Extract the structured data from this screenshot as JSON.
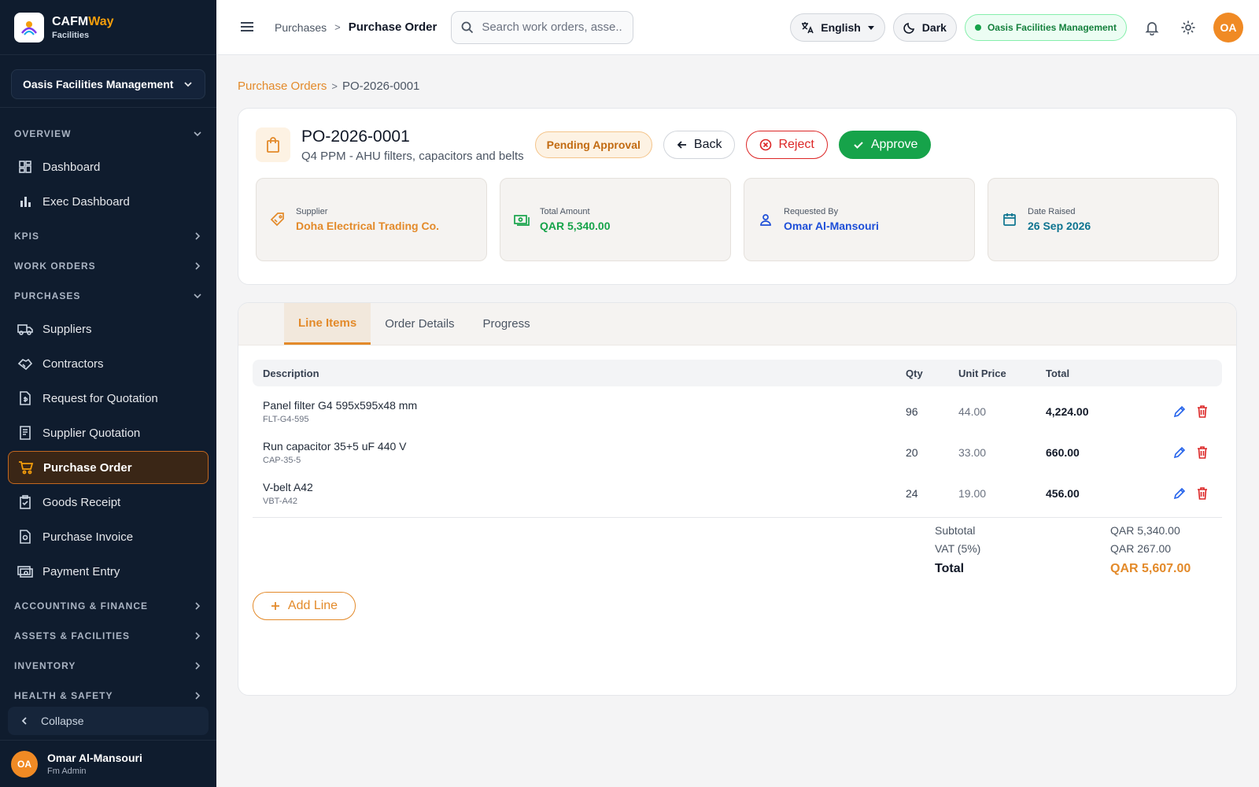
{
  "brand": {
    "name_main": "CAFM",
    "name_accent": "Way",
    "subtitle": "Facilities"
  },
  "sidebar": {
    "org": "Oasis Facilities Management",
    "sections": {
      "overview": "OVERVIEW",
      "kpis": "KPIS",
      "work_orders": "WORK ORDERS",
      "purchases": "PURCHASES",
      "accounting": "ACCOUNTING & FINANCE",
      "assets": "ASSETS & FACILITIES",
      "inventory": "INVENTORY",
      "health": "HEALTH & SAFETY"
    },
    "overview_items": [
      {
        "label": "Dashboard",
        "icon": "dashboard-icon"
      },
      {
        "label": "Exec Dashboard",
        "icon": "bar-chart-icon"
      }
    ],
    "purchase_items": [
      {
        "label": "Suppliers",
        "icon": "truck-icon"
      },
      {
        "label": "Contractors",
        "icon": "handshake-icon"
      },
      {
        "label": "Request for Quotation",
        "icon": "document-dollar-icon"
      },
      {
        "label": "Supplier Quotation",
        "icon": "receipt-icon"
      },
      {
        "label": "Purchase Order",
        "icon": "cart-icon",
        "active": true
      },
      {
        "label": "Goods Receipt",
        "icon": "clipboard-check-icon"
      },
      {
        "label": "Purchase Invoice",
        "icon": "invoice-icon"
      },
      {
        "label": "Payment Entry",
        "icon": "payment-icon"
      }
    ],
    "collapse_label": "Collapse",
    "user": {
      "initials": "OA",
      "name": "Omar Al-Mansouri",
      "role": "Fm Admin"
    }
  },
  "header": {
    "breadcrumb_parent": "Purchases",
    "breadcrumb_current": "Purchase Order",
    "search_placeholder": "Search work orders, asse...",
    "language": "English",
    "theme_label": "Dark",
    "org_badge": "Oasis Facilities Management",
    "avatar_initials": "OA"
  },
  "page": {
    "breadcrumb_link": "Purchase Orders",
    "breadcrumb_current": "PO-2026-0001",
    "po_number": "PO-2026-0001",
    "po_subtitle": "Q4 PPM - AHU filters, capacitors and belts",
    "status": "Pending Approval",
    "buttons": {
      "back": "Back",
      "reject": "Reject",
      "approve": "Approve"
    },
    "stats": [
      {
        "label": "Supplier",
        "value": "Doha Electrical Trading Co.",
        "color": "#e38a2a",
        "icon": "tag-icon"
      },
      {
        "label": "Total Amount",
        "value": "QAR 5,340.00",
        "color": "#16a34a",
        "icon": "cash-icon"
      },
      {
        "label": "Requested By",
        "value": "Omar Al-Mansouri",
        "color": "#1d4ed8",
        "icon": "person-icon"
      },
      {
        "label": "Date Raised",
        "value": "26 Sep 2026",
        "color": "#0e7490",
        "icon": "calendar-icon"
      }
    ],
    "tabs": [
      "Line Items",
      "Order Details",
      "Progress"
    ],
    "table": {
      "headers": {
        "description": "Description",
        "qty": "Qty",
        "unit_price": "Unit Price",
        "total": "Total"
      },
      "rows": [
        {
          "name": "Panel filter G4 595x595x48 mm",
          "code": "FLT-G4-595",
          "qty": "96",
          "unit_price": "44.00",
          "total": "4,224.00"
        },
        {
          "name": "Run capacitor 35+5 uF 440 V",
          "code": "CAP-35-5",
          "qty": "20",
          "unit_price": "33.00",
          "total": "660.00"
        },
        {
          "name": "V-belt A42",
          "code": "VBT-A42",
          "qty": "24",
          "unit_price": "19.00",
          "total": "456.00"
        }
      ]
    },
    "summary": {
      "subtotal_label": "Subtotal",
      "subtotal_value": "QAR 5,340.00",
      "vat_label": "VAT (5%)",
      "vat_value": "QAR 267.00",
      "total_label": "Total",
      "total_value": "QAR 5,607.00"
    },
    "add_line_label": "Add Line"
  },
  "colors": {
    "accent": "#e38a2a",
    "sidebar_bg": "#0f1c2e",
    "approve": "#16a34a",
    "reject": "#dc2626"
  }
}
